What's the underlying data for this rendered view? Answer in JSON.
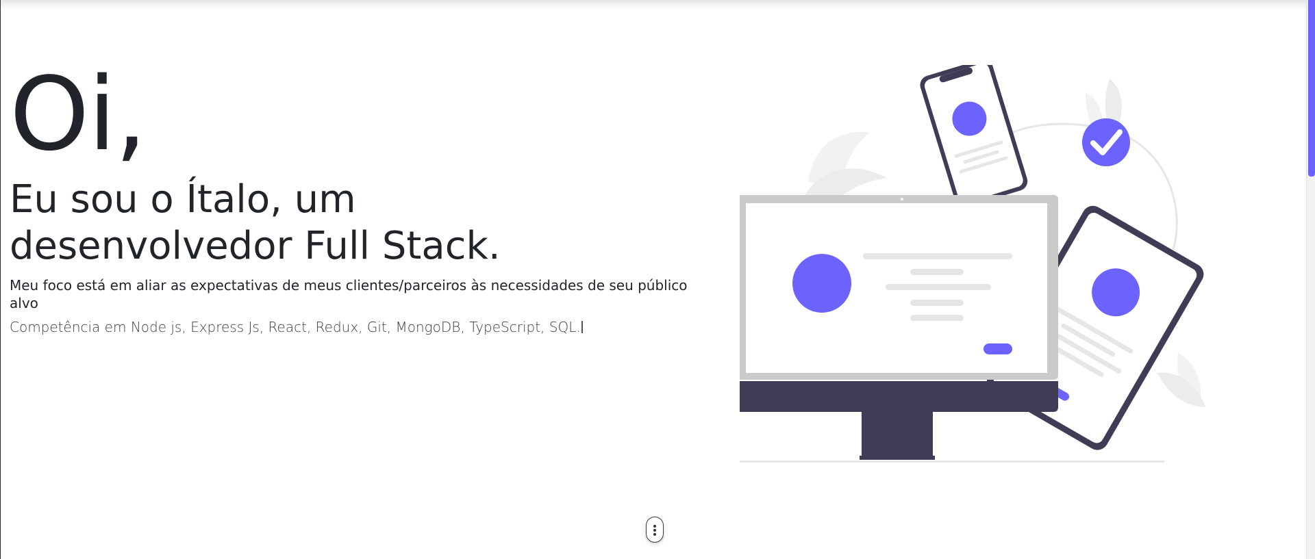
{
  "hero": {
    "greeting": "Oi,",
    "title": "Eu sou o Ítalo, um desenvolvedor Full Stack.",
    "subtitle": "Meu foco está em aliar as expectativas de meus clientes/parceiros às necessidades de seu público alvo",
    "skills": "Competência em Node js, Express Js, React, Redux, Git, MongoDB, TypeScript, SQL."
  },
  "illustration": {
    "name": "responsive-devices-illustration",
    "colors": {
      "accent": "#6c63ff",
      "dark": "#3f3d56",
      "frame_gray": "#cacaca",
      "light_gray": "#e6e6e6",
      "leaf": "#f2f2f2"
    }
  },
  "scroll_indicator": {
    "icon": "mouse-scroll-icon"
  },
  "scrollbar": {
    "thumb_color": "#6c63ff"
  }
}
